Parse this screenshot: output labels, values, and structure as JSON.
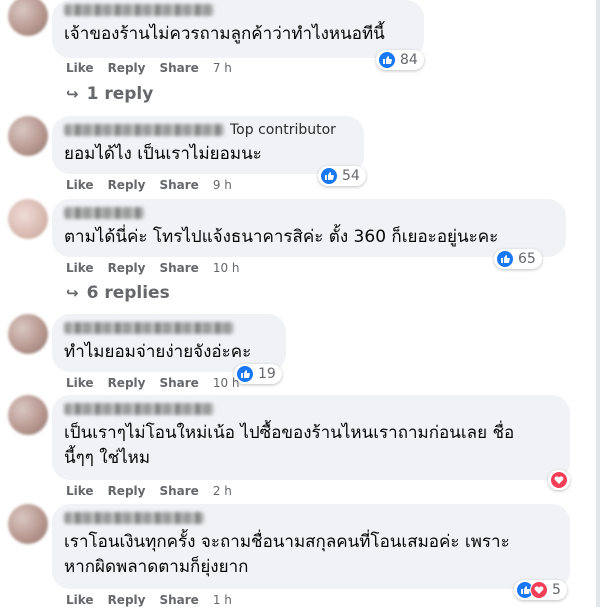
{
  "actions": {
    "like": "Like",
    "reply": "Reply",
    "share": "Share"
  },
  "colors": {
    "like": "#1877f2",
    "love": "#f33e58",
    "bubble": "#f0f2f5",
    "meta": "#65676b"
  },
  "comments": [
    {
      "author_badge": "",
      "text": "เจ้าของร้านไม่ควรถามลูกค้าว่าทำไงหนอทีนี้",
      "time": "7 h",
      "reactions": [
        "like-icon"
      ],
      "reaction_count": "84",
      "replies_label": "1 reply"
    },
    {
      "author_badge": "Top contributor",
      "text": "ยอมได้ไง เป็นเราไม่ยอมนะ",
      "time": "9 h",
      "reactions": [
        "like-icon"
      ],
      "reaction_count": "54",
      "replies_label": ""
    },
    {
      "author_badge": "",
      "text": "ตามได้นี่ค่ะ โทรไปแจ้งธนาคารสิค่ะ ตั้ง 360 ก็เยอะอยู่นะคะ",
      "time": "10 h",
      "reactions": [
        "like-icon"
      ],
      "reaction_count": "65",
      "replies_label": "6 replies"
    },
    {
      "author_badge": "",
      "text": "ทำไมยอมจ่ายง่ายจังอ่ะคะ",
      "time": "10 h",
      "reactions": [
        "like-icon"
      ],
      "reaction_count": "19",
      "replies_label": ""
    },
    {
      "author_badge": "",
      "text_line1": "เป็นเราๆไม่โอนใหม่เน้อ ไปซื้อของร้านไหนเราถามก่อนเลย ชื่อ",
      "text_line2": "นี้ๆๆ ใช่ไหม",
      "time": "2 h",
      "reactions": [
        "love-icon"
      ],
      "reaction_count": "",
      "replies_label": ""
    },
    {
      "author_badge": "",
      "text_line1": "เราโอนเงินทุกครั้ง จะถามชื่อนามสกุลคนที่โอนเสมอค่ะ เพราะ",
      "text_line2": "หากผิดพลาดตามก็ยุ่งยาก",
      "time": "1 h",
      "reactions": [
        "like-icon",
        "love-icon"
      ],
      "reaction_count": "5",
      "replies_label": ""
    }
  ]
}
